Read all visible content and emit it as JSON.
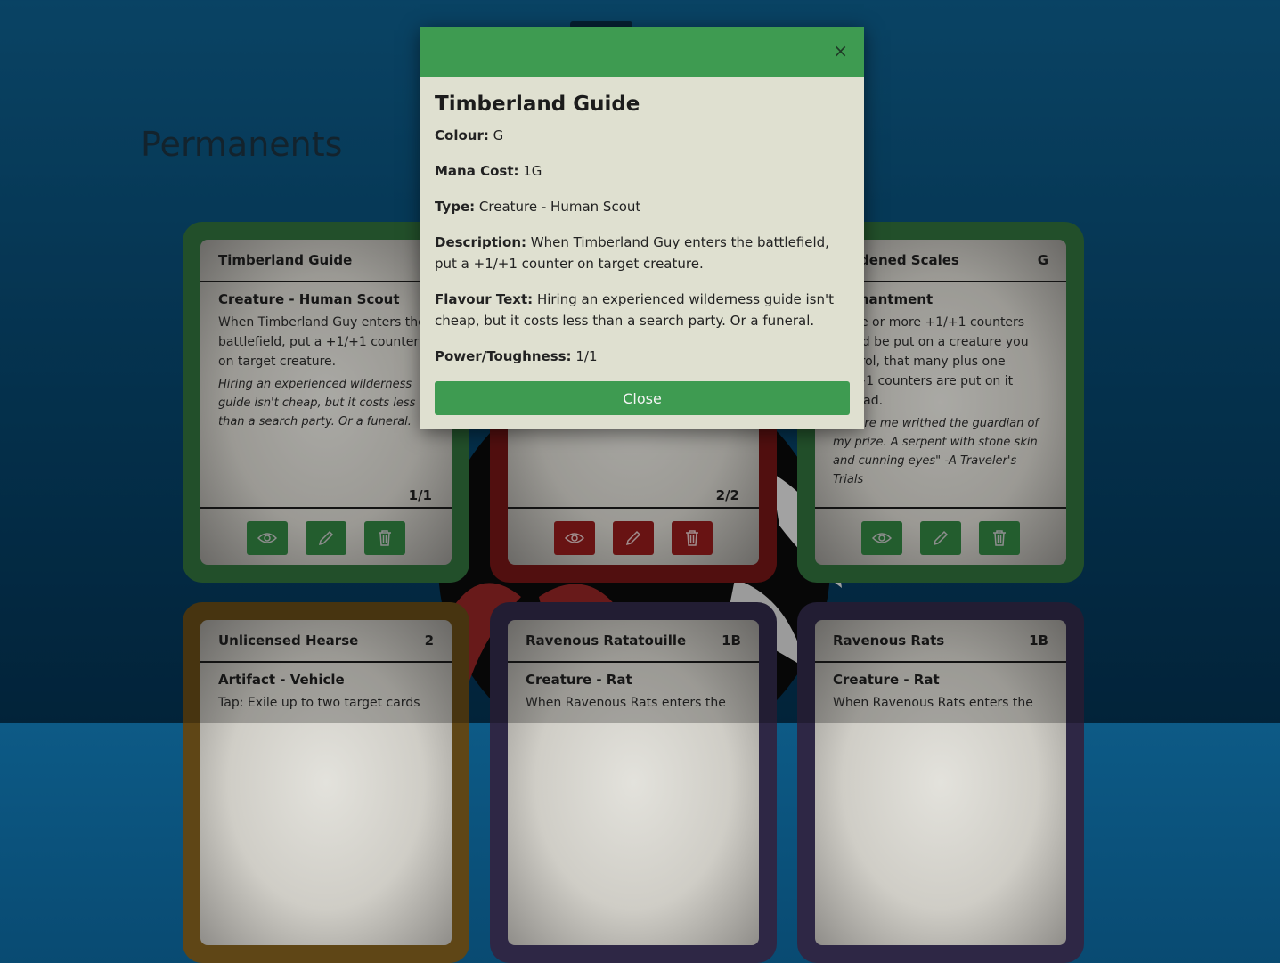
{
  "page": {
    "title": "Permanents"
  },
  "cards": [
    {
      "name": "Timberland Guide",
      "cost": "1",
      "type": "Creature - Human Scout",
      "description": "When Timberland Guy enters the battlefield, put a +1/+1 counter on target creature.",
      "flavour": "Hiring an experienced wilderness guide isn't cheap, but it costs less than a search party. Or a funeral.",
      "pt": "1/1"
    },
    {
      "name": "",
      "cost": "",
      "type": "",
      "description": "",
      "flavour": "",
      "pt": "2/2"
    },
    {
      "name": "Hardened Scales",
      "cost": "G",
      "type": "Enchantment",
      "description": "If one or more +1/+1 counters would be put on a creature you control, that many plus one +1/+1 counters are put on it instead.",
      "flavour": "\"Before me writhed the guardian of my prize. A serpent with stone skin and cunning eyes\" -A Traveler's Trials",
      "pt": ""
    },
    {
      "name": "Unlicensed Hearse",
      "cost": "2",
      "type": "Artifact - Vehicle",
      "description": "Tap: Exile up to two target cards",
      "flavour": "",
      "pt": ""
    },
    {
      "name": "Ravenous Ratatouille",
      "cost": "1B",
      "type": "Creature - Rat",
      "description": "When Ravenous Rats enters the",
      "flavour": "",
      "pt": ""
    },
    {
      "name": "Ravenous Rats",
      "cost": "1B",
      "type": "Creature - Rat",
      "description": "When Ravenous Rats enters the",
      "flavour": "",
      "pt": ""
    }
  ],
  "modal": {
    "title": "Timberland Guide",
    "colour_label": "Colour:",
    "colour": "G",
    "mana_label": "Mana Cost:",
    "mana": "1G",
    "type_label": "Type:",
    "type": "Creature - Human Scout",
    "description_label": "Description:",
    "description": "When Timberland Guy enters the battlefield, put a +1/+1 counter on target creature.",
    "flavour_label": "Flavour Text:",
    "flavour": "Hiring an experienced wilderness guide isn't cheap, but it costs less than a search party. Or a funeral.",
    "pt_label": "Power/Toughness:",
    "pt": "1/1",
    "close_label": "Close",
    "close_icon": "×"
  },
  "colors": {
    "green": "#3e9b51",
    "red": "#6d1414",
    "brown": "#5f4616",
    "purple": "#2e2745"
  }
}
